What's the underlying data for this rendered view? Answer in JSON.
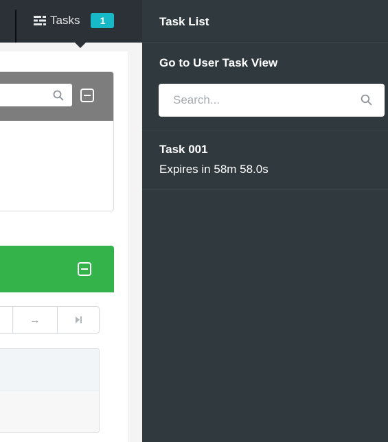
{
  "navbar": {
    "tasks_label": "Tasks",
    "tasks_count": "1",
    "icons": {
      "tasks": "list-icon"
    }
  },
  "left_panel": {
    "icons": {
      "search": "search-icon",
      "collapse": "collapse-icon",
      "next": "arrow-right-icon",
      "last": "last-page-icon"
    },
    "pager": {
      "next_symbol": "→",
      "last_symbol": "⏭"
    }
  },
  "task_list": {
    "title": "Task List",
    "user_task_view_link": "Go to User Task View",
    "search_placeholder": "Search...",
    "tasks": [
      {
        "name": "Task 001",
        "expiry": "Expires in 58m 58.0s"
      }
    ]
  },
  "colors": {
    "navbar_bg": "#2b3136",
    "panel_bg": "#2f393e",
    "badge": "#17b8c8",
    "box_header_gray": "#7d7d7d",
    "box_header_green": "#33b34a"
  }
}
